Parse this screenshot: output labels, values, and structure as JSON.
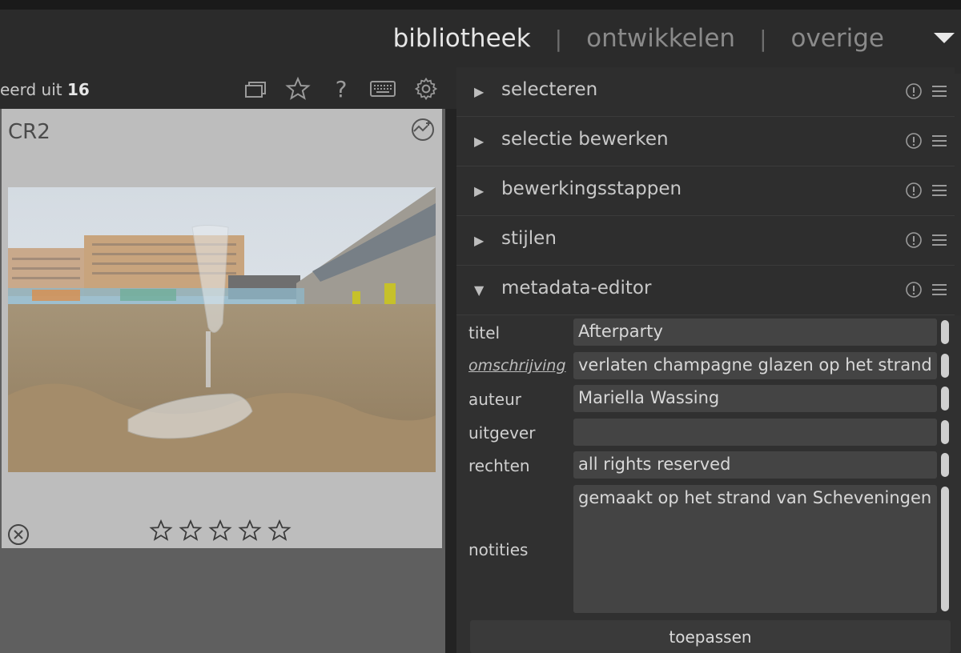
{
  "header": {
    "views": [
      {
        "label": "bibliotheek",
        "active": true
      },
      {
        "label": "ontwikkelen",
        "active": false
      },
      {
        "label": "overige",
        "active": false
      }
    ],
    "separator": "|"
  },
  "toolbar": {
    "count_prefix": "eerd uit",
    "count_total": "16",
    "icons": [
      "grouping-icon",
      "star-icon",
      "help-icon",
      "keyboard-icon",
      "gear-icon"
    ],
    "help_glyph": "?"
  },
  "thumbnail": {
    "extension": "CR2",
    "rating_max": 5,
    "rating_value": 0,
    "photo_description_icon": "photo"
  },
  "modules": [
    {
      "label": "selecteren",
      "expanded": false
    },
    {
      "label": "selectie bewerken",
      "expanded": false
    },
    {
      "label": "bewerkingsstappen",
      "expanded": false
    },
    {
      "label": "stijlen",
      "expanded": false
    },
    {
      "label": "metadata-editor",
      "expanded": true
    }
  ],
  "metadata_editor": {
    "labels": {
      "title": "titel",
      "description": "omschrijving",
      "creator": "auteur",
      "publisher": "uitgever",
      "rights": "rechten",
      "notes": "notities"
    },
    "values": {
      "title": "Afterparty",
      "description": "verlaten champagne glazen op het strand",
      "creator": "Mariella Wassing",
      "publisher": "",
      "rights": "all rights reserved",
      "notes": "gemaakt op het strand van Scheveningen"
    },
    "apply_label": "toepassen"
  },
  "colors": {
    "background": "#2b2b2b",
    "panel": "#2e2e2e",
    "field": "#444444",
    "thumbnail_bg": "#bdbdbd",
    "active_view": "#e6e6e6",
    "inactive_view": "#8a8a8a"
  }
}
